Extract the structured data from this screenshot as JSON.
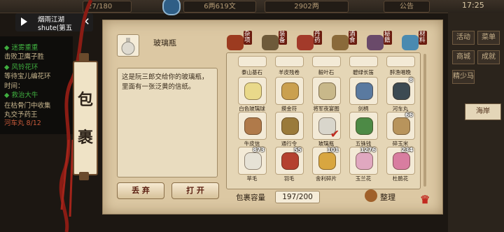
{
  "top_bar": {
    "stat1": "27/180",
    "money": "6两619文",
    "gems": "2902两",
    "notice": "公告",
    "time": "17:25"
  },
  "video": {
    "title_line1": "烟雨江湖",
    "title_line2": "shute(第五"
  },
  "quests": [
    {
      "text": "◆ 迷雾重重",
      "color": "#3fae3f"
    },
    {
      "text": "击败卫鹰子胜",
      "color": "#c9b78f"
    },
    {
      "text": "◆ 风铃花环",
      "color": "#3fae3f"
    },
    {
      "text": "等待宝儿编花环",
      "color": "#c9b78f"
    },
    {
      "text": "时间：",
      "color": "#c9b78f"
    },
    {
      "text": "◆ 救治大牛",
      "color": "#3fae3f"
    },
    {
      "text": "在枯骨门中收集",
      "color": "#c9b78f"
    },
    {
      "text": "丸交予药王",
      "color": "#c9b78f"
    },
    {
      "text": "河车丸 8/12",
      "color": "#c85a3a"
    }
  ],
  "right_menu": {
    "row1": [
      "活动",
      "菜单"
    ],
    "row2": [
      "商城",
      "成就"
    ],
    "row3": [
      "精少马",
      ""
    ],
    "map_button": "海岸"
  },
  "bag": {
    "title_char1": "包",
    "title_char2": "裹",
    "selected_item_name": "玻璃瓶",
    "selected_item_desc": "这是阮三郎交给你的玻璃瓶，里面有一张泛黄的信纸。",
    "discard_label": "丢 弃",
    "open_label": "打 开",
    "capacity_label": "包裹容量",
    "capacity_value": "197/200",
    "organize_label": "整理"
  },
  "tabs": [
    "杂项",
    "装备",
    "丹药",
    "酒食",
    "秘籍",
    "材料"
  ],
  "row0_names": [
    "泰山基石",
    "羊皮残卷",
    "毅叶石",
    "碧绿长笛",
    "醉渔唱晚"
  ],
  "items": [
    {
      "name": "白色玻璃球",
      "count": "",
      "icon": "white-glass-ball-icon",
      "color": "#e9d98a"
    },
    {
      "name": "摸金符",
      "count": "",
      "icon": "mojin-talisman-icon",
      "color": "#caa04f"
    },
    {
      "name": "将军夜宴图",
      "count": "",
      "icon": "painting-scroll-icon",
      "color": "#c8b88a"
    },
    {
      "name": "剑柄",
      "count": "",
      "icon": "sword-hilt-icon",
      "color": "#5a7aa0"
    },
    {
      "name": "河车丸",
      "count": "8",
      "icon": "pill-bowl-icon",
      "color": "#3c4a52"
    },
    {
      "name": "牛皮信",
      "count": "",
      "icon": "leather-letter-icon",
      "color": "#b07a4a"
    },
    {
      "name": "通行令",
      "count": "",
      "icon": "pass-token-icon",
      "color": "#9a7a3a"
    },
    {
      "name": "玻璃瓶",
      "count": "",
      "icon": "glass-bottle-icon",
      "color": "#d9d6cc"
    },
    {
      "name": "五铢钱",
      "count": "",
      "icon": "coin-icon",
      "color": "#4d8a46"
    },
    {
      "name": "碎玉米",
      "count": "66",
      "icon": "corn-sack-icon",
      "color": "#b8945c"
    },
    {
      "name": "苹毛",
      "count": "873",
      "icon": "cotton-icon",
      "color": "#e6e2d6"
    },
    {
      "name": "羽毛",
      "count": "55",
      "icon": "feather-icon",
      "color": "#b4412f"
    },
    {
      "name": "舍利碎片",
      "count": "101",
      "icon": "relic-fragment-icon",
      "color": "#d8a640"
    },
    {
      "name": "玉兰花",
      "count": "1276",
      "icon": "magnolia-icon",
      "color": "#e0a8c0"
    },
    {
      "name": "杜鹃花",
      "count": "234",
      "icon": "azalea-icon",
      "color": "#d87da0"
    }
  ]
}
